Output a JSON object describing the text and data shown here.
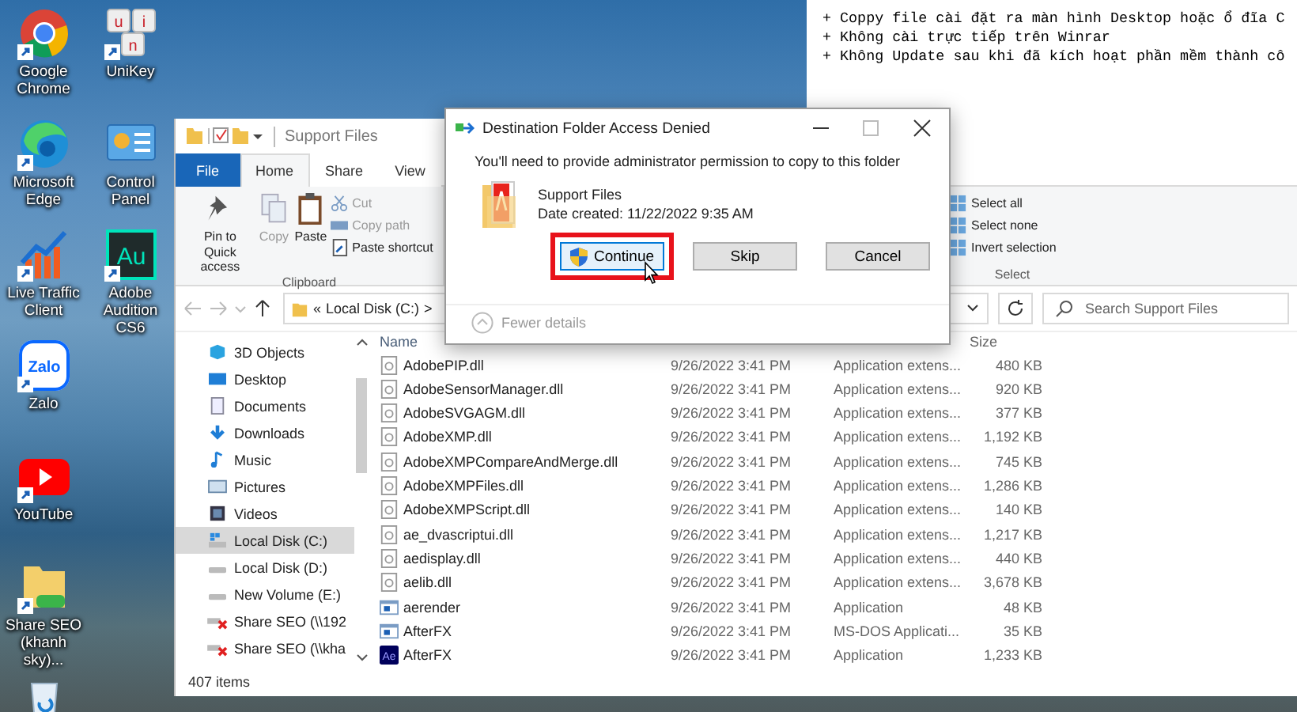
{
  "desktop": {
    "icons": [
      {
        "kind": "chrome",
        "label": "Google Chrome",
        "shortcut": true
      },
      {
        "kind": "edge",
        "label": "Microsoft Edge",
        "shortcut": true
      },
      {
        "kind": "chart",
        "label": "Live Traffic Client",
        "shortcut": true
      },
      {
        "kind": "zalo",
        "label": "Zalo",
        "badge": "Zalo",
        "shortcut": true
      },
      {
        "kind": "youtube",
        "label": "YouTube",
        "shortcut": true
      },
      {
        "kind": "folder",
        "label": "Share SEO (khanh sky)...",
        "shortcut": true
      },
      {
        "kind": "recycle",
        "shortcut": false
      },
      {
        "kind": "keys",
        "label": "UniKey",
        "keys": [
          "u",
          "i",
          "n"
        ],
        "shortcut": true
      },
      {
        "kind": "control",
        "label": "Control Panel",
        "shortcut": false
      },
      {
        "kind": "audition",
        "label": "Adobe Audition CS6",
        "badge": "Au",
        "shortcut": true
      }
    ]
  },
  "notepad": {
    "lines": [
      "+ Coppy file cài đặt ra màn hình Desktop hoặc ổ đĩa C",
      "+ Không cài trực tiếp trên Winrar",
      "+ Không Update sau khi đã kích hoạt phần mềm thành cô"
    ]
  },
  "explorer": {
    "title": "Support Files",
    "tabs": [
      {
        "label": "File",
        "kind": "file",
        "selected": false
      },
      {
        "label": "Home",
        "kind": "tab",
        "selected": true
      },
      {
        "label": "Share",
        "kind": "tab",
        "selected": false
      },
      {
        "label": "View",
        "kind": "tab",
        "selected": false
      }
    ],
    "clipboard": {
      "label": "Clipboard",
      "large": [
        {
          "kind": "pin",
          "label": "Pin to Quick access",
          "disabled": false
        },
        {
          "kind": "copy",
          "label": "Copy",
          "disabled": true
        },
        {
          "kind": "paste",
          "label": "Paste",
          "disabled": false
        }
      ],
      "small": [
        {
          "kind": "cut",
          "label": "Cut",
          "disabled": true
        },
        {
          "kind": "path",
          "label": "Copy path",
          "disabled": true
        },
        {
          "kind": "shortcut",
          "label": "Paste shortcut",
          "disabled": false
        }
      ]
    },
    "select": {
      "label": "Select",
      "items": [
        {
          "label": "Select all"
        },
        {
          "label": "Select none"
        },
        {
          "label": "Invert selection"
        }
      ]
    },
    "address": {
      "overflow": "«",
      "path": "Local Disk (C:)",
      "separator": ">"
    },
    "search": {
      "placeholder": "Search Support Files"
    },
    "nav": [
      {
        "kind": "cube",
        "label": "3D Objects",
        "selected": false
      },
      {
        "kind": "desktop",
        "label": "Desktop",
        "selected": false
      },
      {
        "kind": "document",
        "label": "Documents",
        "selected": false
      },
      {
        "kind": "download",
        "label": "Downloads",
        "selected": false
      },
      {
        "kind": "music",
        "label": "Music",
        "selected": false
      },
      {
        "kind": "picture",
        "label": "Pictures",
        "selected": false
      },
      {
        "kind": "video",
        "label": "Videos",
        "selected": false
      },
      {
        "kind": "system",
        "label": "Local Disk (C:)",
        "selected": true
      },
      {
        "kind": "drive",
        "label": "Local Disk (D:)",
        "selected": false
      },
      {
        "kind": "drive",
        "label": "New Volume (E:)",
        "selected": false
      },
      {
        "kind": "offline",
        "label": "Share SEO (\\\\192",
        "selected": false
      },
      {
        "kind": "offline",
        "label": "Share SEO (\\\\kha",
        "selected": false
      }
    ],
    "columns": {
      "name": "Name",
      "size": "Size"
    },
    "files": [
      {
        "kind": "dll",
        "name": "AdobePIP.dll",
        "date": "9/26/2022 3:41 PM",
        "type": "Application extens...",
        "size": "480 KB"
      },
      {
        "kind": "dll",
        "name": "AdobeSensorManager.dll",
        "date": "9/26/2022 3:41 PM",
        "type": "Application extens...",
        "size": "920 KB"
      },
      {
        "kind": "dll",
        "name": "AdobeSVGAGM.dll",
        "date": "9/26/2022 3:41 PM",
        "type": "Application extens...",
        "size": "377 KB"
      },
      {
        "kind": "dll",
        "name": "AdobeXMP.dll",
        "date": "9/26/2022 3:41 PM",
        "type": "Application extens...",
        "size": "1,192 KB"
      },
      {
        "kind": "dll",
        "name": "AdobeXMPCompareAndMerge.dll",
        "date": "9/26/2022 3:41 PM",
        "type": "Application extens...",
        "size": "745 KB"
      },
      {
        "kind": "dll",
        "name": "AdobeXMPFiles.dll",
        "date": "9/26/2022 3:41 PM",
        "type": "Application extens...",
        "size": "1,286 KB"
      },
      {
        "kind": "dll",
        "name": "AdobeXMPScript.dll",
        "date": "9/26/2022 3:41 PM",
        "type": "Application extens...",
        "size": "140 KB"
      },
      {
        "kind": "dll",
        "name": "ae_dvascriptui.dll",
        "date": "9/26/2022 3:41 PM",
        "type": "Application extens...",
        "size": "1,217 KB"
      },
      {
        "kind": "dll",
        "name": "aedisplay.dll",
        "date": "9/26/2022 3:41 PM",
        "type": "Application extens...",
        "size": "440 KB"
      },
      {
        "kind": "dll",
        "name": "aelib.dll",
        "date": "9/26/2022 3:41 PM",
        "type": "Application extens...",
        "size": "3,678 KB"
      },
      {
        "kind": "app",
        "name": "aerender",
        "date": "9/26/2022 3:41 PM",
        "type": "Application",
        "size": "48 KB"
      },
      {
        "kind": "app",
        "name": "AfterFX",
        "date": "9/26/2022 3:41 PM",
        "type": "MS-DOS Applicati...",
        "size": "35 KB"
      },
      {
        "kind": "ae",
        "badge": "Ae",
        "name": "AfterFX",
        "date": "9/26/2022 3:41 PM",
        "type": "Application",
        "size": "1,233 KB"
      }
    ],
    "status": "407 items"
  },
  "dialog": {
    "title": "Destination Folder Access Denied",
    "message": "You'll need to provide administrator permission to copy to this folder",
    "item": {
      "name": "Support Files",
      "date": "Date created: 11/22/2022 9:35 AM"
    },
    "buttons": [
      {
        "label": "Continue",
        "shield": true,
        "highlighted": true,
        "focused": true
      },
      {
        "label": "Skip",
        "shield": false,
        "highlighted": false,
        "focused": false
      },
      {
        "label": "Cancel",
        "shield": false,
        "highlighted": false,
        "focused": false
      }
    ],
    "details": "Fewer details"
  }
}
